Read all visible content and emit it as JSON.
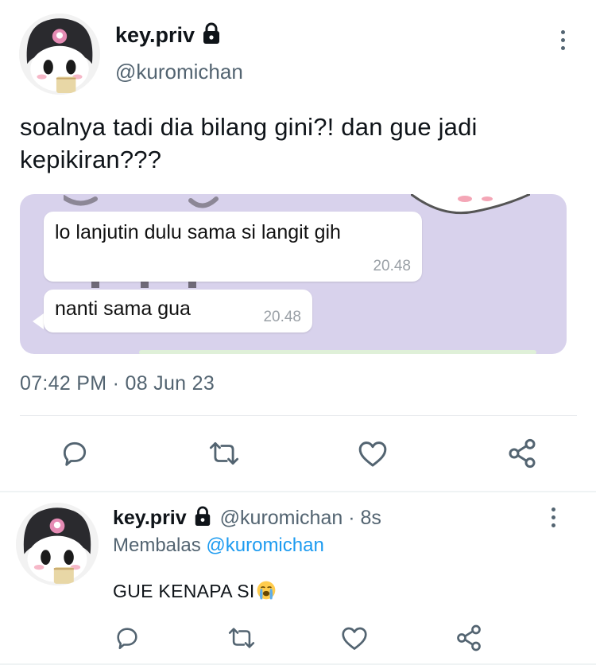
{
  "main_tweet": {
    "display_name": "key.priv",
    "handle": "@kuromichan",
    "text_line1": "soalnya tadi dia bilang gini?! dan gue jadi",
    "text_line2": "kepikiran???",
    "media": {
      "bubbles": [
        {
          "text": "lo lanjutin dulu sama si langit gih",
          "time": "20.48"
        },
        {
          "text": "nanti sama gua",
          "time": "20.48"
        }
      ]
    },
    "timestamp": "07:42 PM · 08 Jun 23"
  },
  "reply_tweet": {
    "display_name": "key.priv",
    "handle_time": "@kuromichan · 8s",
    "replying_to_label": "Membalas",
    "replying_to_handle": "@kuromichan",
    "text": "GUE KENAPA SI"
  },
  "icons": {
    "reply": "comment-icon",
    "retweet": "retweet-icon",
    "like": "heart-icon",
    "share": "share-icon",
    "lock": "lock-icon",
    "more": "more-vertical-icon",
    "emoji": "loudly-crying-face"
  },
  "colors": {
    "text": "#0f1419",
    "secondary": "#536471",
    "link": "#1d9bf0",
    "media_bg": "#d8d2ec"
  }
}
